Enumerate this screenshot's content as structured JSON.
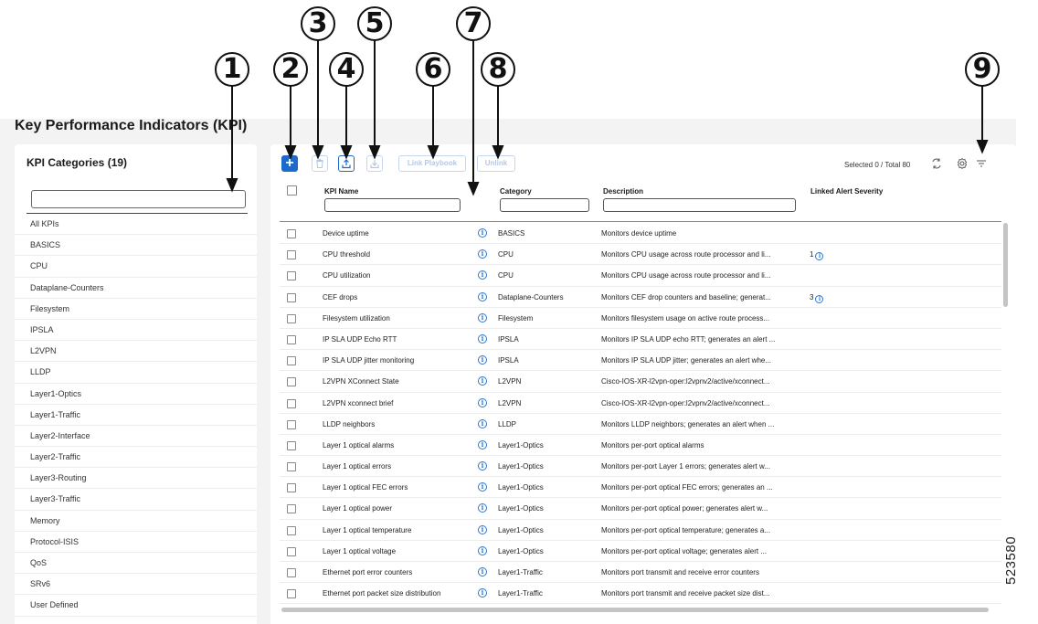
{
  "page": {
    "title": "Key Performance Indicators (KPI)",
    "figure_id": "523580"
  },
  "callouts": [
    "1",
    "2",
    "3",
    "4",
    "5",
    "6",
    "7",
    "8",
    "9"
  ],
  "categories": {
    "title": "KPI Categories (19)",
    "search_placeholder": "",
    "items": [
      "All KPIs",
      "BASICS",
      "CPU",
      "Dataplane-Counters",
      "Filesystem",
      "IPSLA",
      "L2VPN",
      "LLDP",
      "Layer1-Optics",
      "Layer1-Traffic",
      "Layer2-Interface",
      "Layer2-Traffic",
      "Layer3-Routing",
      "Layer3-Traffic",
      "Memory",
      "Protocol-ISIS",
      "QoS",
      "SRv6",
      "User Defined"
    ]
  },
  "toolbar": {
    "add_label": "+",
    "link_playbook_label": "Link Playbook",
    "unlink_label": "Unlink",
    "selection_info": "Selected 0 / Total 80",
    "icons": [
      "plus-icon",
      "trash-icon",
      "upload-icon",
      "download-icon",
      "refresh-icon",
      "gear-icon",
      "filter-icon"
    ]
  },
  "table": {
    "columns": {
      "name": "KPI Name",
      "category": "Category",
      "description": "Description",
      "severity": "Linked Alert Severity"
    },
    "rows": [
      {
        "name": "Device uptime",
        "category": "BASICS",
        "description": "Monitors device uptime",
        "severity": ""
      },
      {
        "name": "CPU threshold",
        "category": "CPU",
        "description": "Monitors CPU usage across route processor and li...",
        "severity": "1"
      },
      {
        "name": "CPU utilization",
        "category": "CPU",
        "description": "Monitors CPU usage across route processor and li...",
        "severity": ""
      },
      {
        "name": "CEF drops",
        "category": "Dataplane-Counters",
        "description": "Monitors CEF drop counters and baseline; generat...",
        "severity": "3"
      },
      {
        "name": "Filesystem utilization",
        "category": "Filesystem",
        "description": "Monitors filesystem usage on active route process...",
        "severity": ""
      },
      {
        "name": "IP SLA UDP Echo RTT",
        "category": "IPSLA",
        "description": "Monitors IP SLA UDP echo RTT; generates an alert ...",
        "severity": ""
      },
      {
        "name": "IP SLA UDP jitter monitoring",
        "category": "IPSLA",
        "description": "Monitors IP SLA UDP jitter; generates an alert whe...",
        "severity": ""
      },
      {
        "name": "L2VPN XConnect State",
        "category": "L2VPN",
        "description": "Cisco-IOS-XR-l2vpn-oper:l2vpnv2/active/xconnect...",
        "severity": ""
      },
      {
        "name": "L2VPN xconnect brief",
        "category": "L2VPN",
        "description": "Cisco-IOS-XR-l2vpn-oper:l2vpnv2/active/xconnect...",
        "severity": ""
      },
      {
        "name": "LLDP neighbors",
        "category": "LLDP",
        "description": "Monitors LLDP neighbors; generates an alert when ...",
        "severity": ""
      },
      {
        "name": "Layer 1 optical alarms",
        "category": "Layer1-Optics",
        "description": "Monitors per-port optical alarms",
        "severity": ""
      },
      {
        "name": "Layer 1 optical errors",
        "category": "Layer1-Optics",
        "description": "Monitors per-port Layer 1 errors; generates alert w...",
        "severity": ""
      },
      {
        "name": "Layer 1 optical FEC errors",
        "category": "Layer1-Optics",
        "description": "Monitors per-port optical FEC errors; generates an ...",
        "severity": ""
      },
      {
        "name": "Layer 1 optical power",
        "category": "Layer1-Optics",
        "description": "Monitors per-port optical power; generates alert w...",
        "severity": ""
      },
      {
        "name": "Layer 1 optical temperature",
        "category": "Layer1-Optics",
        "description": "Monitors per-port optical temperature; generates a...",
        "severity": ""
      },
      {
        "name": "Layer 1 optical voltage",
        "category": "Layer1-Optics",
        "description": "Monitors per-port optical voltage; generates alert ...",
        "severity": ""
      },
      {
        "name": "Ethernet port error counters",
        "category": "Layer1-Traffic",
        "description": "Monitors port transmit and receive error counters",
        "severity": ""
      },
      {
        "name": "Ethernet port packet size distribution",
        "category": "Layer1-Traffic",
        "description": "Monitors port transmit and receive packet size dist...",
        "severity": ""
      }
    ]
  }
}
